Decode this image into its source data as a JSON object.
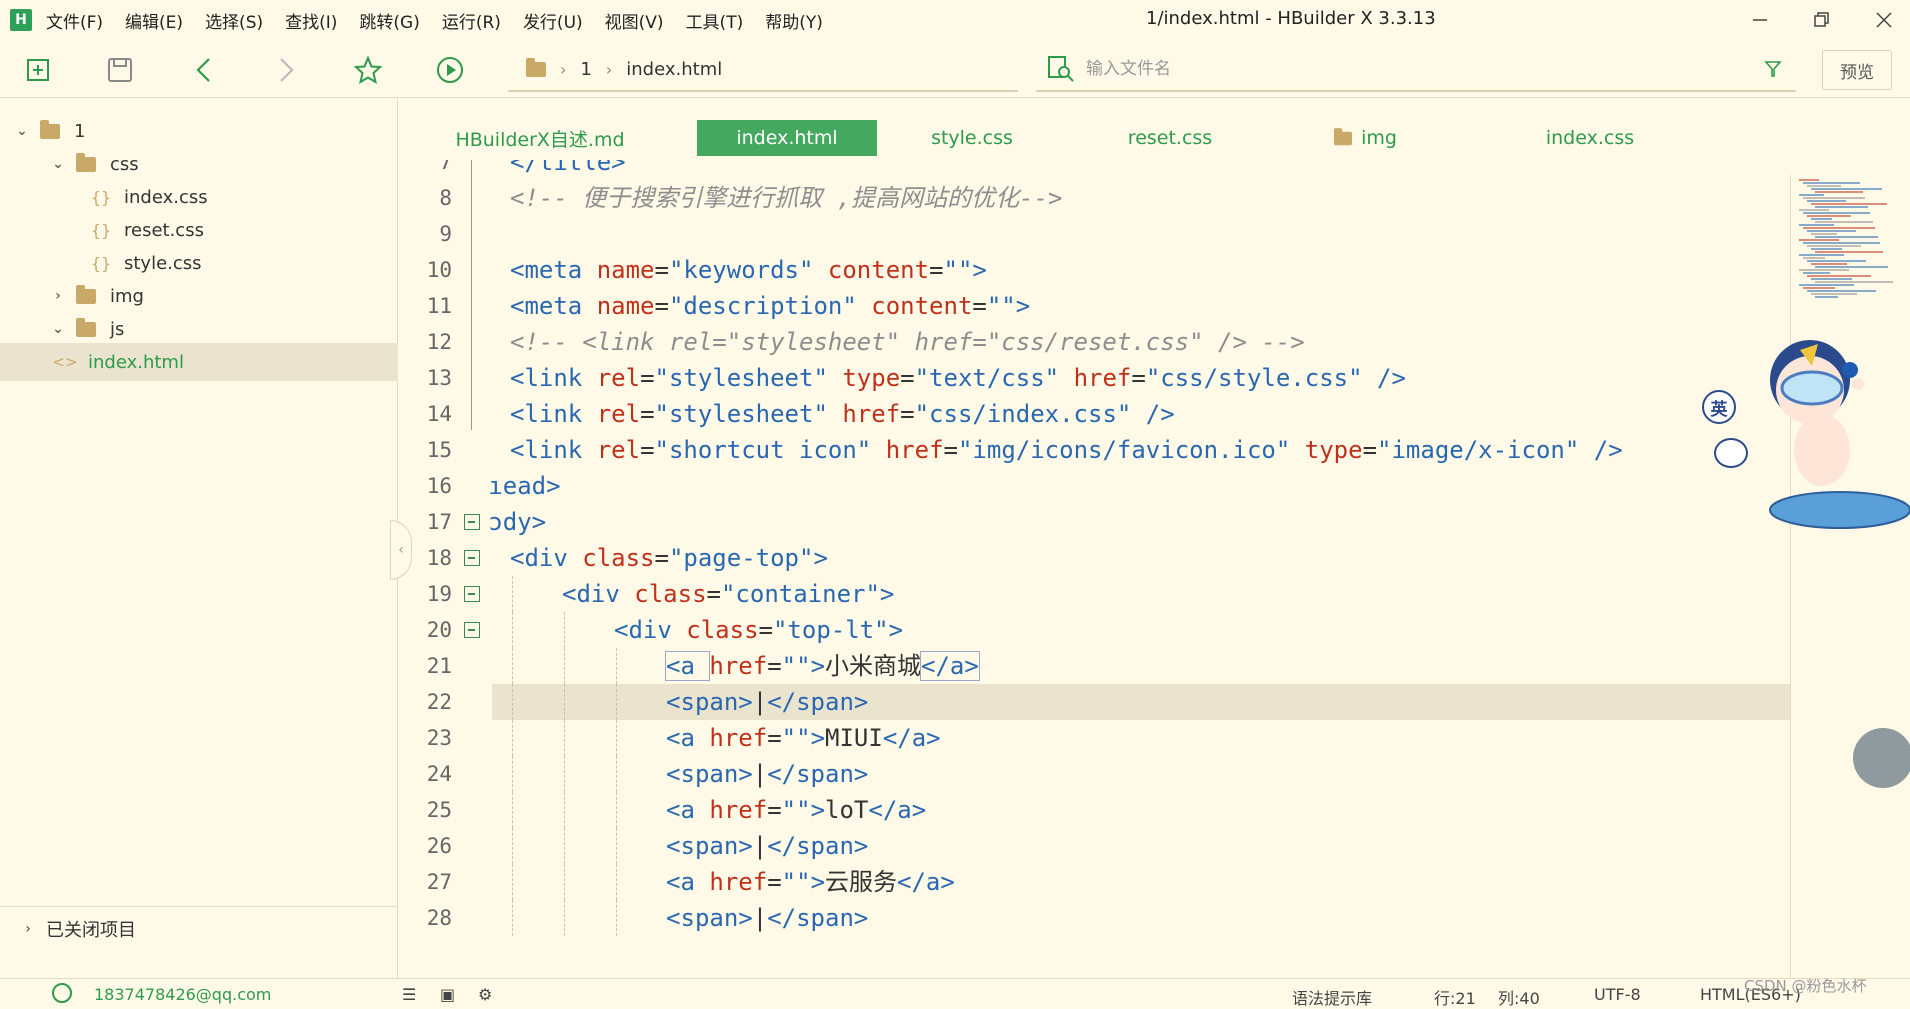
{
  "app": {
    "logo": "H",
    "window_title": "1/index.html - HBuilder X 3.3.13"
  },
  "menu": [
    "文件(F)",
    "编辑(E)",
    "选择(S)",
    "查找(I)",
    "跳转(G)",
    "运行(R)",
    "发行(U)",
    "视图(V)",
    "工具(T)",
    "帮助(Y)"
  ],
  "toolbar": {
    "breadcrumb": [
      "1",
      "index.html"
    ],
    "search_placeholder": "输入文件名",
    "preview_label": "预览"
  },
  "sidebar": {
    "tree": [
      {
        "label": "1",
        "kind": "folder",
        "expanded": true,
        "depth": 0
      },
      {
        "label": "css",
        "kind": "folder",
        "expanded": true,
        "depth": 1
      },
      {
        "label": "index.css",
        "kind": "css",
        "depth": 2
      },
      {
        "label": "reset.css",
        "kind": "css",
        "depth": 2
      },
      {
        "label": "style.css",
        "kind": "css",
        "depth": 2
      },
      {
        "label": "img",
        "kind": "folder",
        "expanded": false,
        "depth": 1
      },
      {
        "label": "js",
        "kind": "folder",
        "expanded": true,
        "depth": 1
      },
      {
        "label": "index.html",
        "kind": "html",
        "depth": 1,
        "selected": true
      }
    ],
    "closed_projects": "已关闭项目"
  },
  "tabs": [
    {
      "label": "HBuilderX自述.md",
      "active": false
    },
    {
      "label": "index.html",
      "active": true
    },
    {
      "label": "style.css",
      "active": false
    },
    {
      "label": "reset.css",
      "active": false
    },
    {
      "label": "img",
      "active": false,
      "folder": true
    },
    {
      "label": "index.css",
      "active": false
    }
  ],
  "editor": {
    "lines": [
      {
        "n": "7",
        "indent": 0,
        "tokens": [
          [
            "tag",
            "</title>"
          ]
        ]
      },
      {
        "n": "8",
        "indent": 0,
        "tokens": [
          [
            "cm",
            "<!-- 便于搜索引擎进行抓取 ,提高网站的优化-->"
          ]
        ]
      },
      {
        "n": "9",
        "indent": 0,
        "tokens": []
      },
      {
        "n": "10",
        "indent": 0,
        "tokens": [
          [
            "tag",
            "<meta "
          ],
          [
            "attr",
            "name"
          ],
          [
            "txt",
            "="
          ],
          [
            "str",
            "\"keywords\""
          ],
          [
            "txt",
            " "
          ],
          [
            "attr",
            "content"
          ],
          [
            "txt",
            "="
          ],
          [
            "str",
            "\"\""
          ],
          [
            "tag",
            ">"
          ]
        ]
      },
      {
        "n": "11",
        "indent": 0,
        "tokens": [
          [
            "tag",
            "<meta "
          ],
          [
            "attr",
            "name"
          ],
          [
            "txt",
            "="
          ],
          [
            "str",
            "\"description\""
          ],
          [
            "txt",
            " "
          ],
          [
            "attr",
            "content"
          ],
          [
            "txt",
            "="
          ],
          [
            "str",
            "\"\""
          ],
          [
            "tag",
            ">"
          ]
        ]
      },
      {
        "n": "12",
        "indent": 0,
        "tokens": [
          [
            "cm",
            "<!-- <link rel=\"stylesheet\" href=\"css/reset.css\" /> -->"
          ]
        ]
      },
      {
        "n": "13",
        "indent": 0,
        "tokens": [
          [
            "tag",
            "<link "
          ],
          [
            "attr",
            "rel"
          ],
          [
            "txt",
            "="
          ],
          [
            "str",
            "\"stylesheet\""
          ],
          [
            "txt",
            " "
          ],
          [
            "attr",
            "type"
          ],
          [
            "txt",
            "="
          ],
          [
            "str",
            "\"text/css\""
          ],
          [
            "txt",
            " "
          ],
          [
            "attr",
            "href"
          ],
          [
            "txt",
            "="
          ],
          [
            "str",
            "\"css/style.css\""
          ],
          [
            "tag",
            " />"
          ]
        ]
      },
      {
        "n": "14",
        "indent": 0,
        "tokens": [
          [
            "tag",
            "<link "
          ],
          [
            "attr",
            "rel"
          ],
          [
            "txt",
            "="
          ],
          [
            "str",
            "\"stylesheet\""
          ],
          [
            "txt",
            " "
          ],
          [
            "attr",
            "href"
          ],
          [
            "txt",
            "="
          ],
          [
            "str",
            "\"css/index.css\""
          ],
          [
            "tag",
            " />"
          ]
        ]
      },
      {
        "n": "15",
        "indent": 0,
        "tokens": [
          [
            "tag",
            "<link "
          ],
          [
            "attr",
            "rel"
          ],
          [
            "txt",
            "="
          ],
          [
            "str",
            "\"shortcut icon\""
          ],
          [
            "txt",
            " "
          ],
          [
            "attr",
            "href"
          ],
          [
            "txt",
            "="
          ],
          [
            "str",
            "\"img/icons/favicon.ico\""
          ],
          [
            "txt",
            " "
          ],
          [
            "attr",
            "type"
          ],
          [
            "txt",
            "="
          ],
          [
            "str",
            "\"image/x-icon\""
          ],
          [
            "tag",
            " />"
          ]
        ]
      },
      {
        "n": "16",
        "indent": -1,
        "tokens": [
          [
            "tag",
            "ıead>"
          ]
        ]
      },
      {
        "n": "17",
        "indent": -1,
        "tokens": [
          [
            "tag",
            "ɔdy>"
          ]
        ]
      },
      {
        "n": "18",
        "indent": 0,
        "tokens": [
          [
            "tag",
            "<div "
          ],
          [
            "attr",
            "class"
          ],
          [
            "txt",
            "="
          ],
          [
            "str",
            "\"page-top\""
          ],
          [
            "tag",
            ">"
          ]
        ]
      },
      {
        "n": "19",
        "indent": 1,
        "tokens": [
          [
            "tag",
            "<div "
          ],
          [
            "attr",
            "class"
          ],
          [
            "txt",
            "="
          ],
          [
            "str",
            "\"container\""
          ],
          [
            "tag",
            ">"
          ]
        ]
      },
      {
        "n": "20",
        "indent": 2,
        "tokens": [
          [
            "tag",
            "<div "
          ],
          [
            "attr",
            "class"
          ],
          [
            "txt",
            "="
          ],
          [
            "str",
            "\"top-lt\""
          ],
          [
            "tag",
            ">"
          ]
        ]
      },
      {
        "n": "21",
        "indent": 3,
        "tokens": [
          [
            "tag",
            "<a "
          ],
          [
            "attr",
            "href"
          ],
          [
            "txt",
            "="
          ],
          [
            "str",
            "\"\""
          ],
          [
            "tag",
            ">"
          ],
          [
            "txt",
            "小米商城"
          ],
          [
            "tag",
            "</a>"
          ]
        ]
      },
      {
        "n": "22",
        "indent": 3,
        "tokens": [
          [
            "tag",
            "<span>"
          ],
          [
            "txt",
            "|"
          ],
          [
            "tag",
            "</span>"
          ]
        ]
      },
      {
        "n": "23",
        "indent": 3,
        "tokens": [
          [
            "tag",
            "<a "
          ],
          [
            "attr",
            "href"
          ],
          [
            "txt",
            "="
          ],
          [
            "str",
            "\"\""
          ],
          [
            "tag",
            ">"
          ],
          [
            "txt",
            "MIUI"
          ],
          [
            "tag",
            "</a>"
          ]
        ]
      },
      {
        "n": "24",
        "indent": 3,
        "tokens": [
          [
            "tag",
            "<span>"
          ],
          [
            "txt",
            "|"
          ],
          [
            "tag",
            "</span>"
          ]
        ]
      },
      {
        "n": "25",
        "indent": 3,
        "tokens": [
          [
            "tag",
            "<a "
          ],
          [
            "attr",
            "href"
          ],
          [
            "txt",
            "="
          ],
          [
            "str",
            "\"\""
          ],
          [
            "tag",
            ">"
          ],
          [
            "txt",
            "loT"
          ],
          [
            "tag",
            "</a>"
          ]
        ]
      },
      {
        "n": "26",
        "indent": 3,
        "tokens": [
          [
            "tag",
            "<span>"
          ],
          [
            "txt",
            "|"
          ],
          [
            "tag",
            "</span>"
          ]
        ]
      },
      {
        "n": "27",
        "indent": 3,
        "tokens": [
          [
            "tag",
            "<a "
          ],
          [
            "attr",
            "href"
          ],
          [
            "txt",
            "="
          ],
          [
            "str",
            "\"\""
          ],
          [
            "tag",
            ">"
          ],
          [
            "txt",
            "云服务"
          ],
          [
            "tag",
            "</a>"
          ]
        ]
      },
      {
        "n": "28",
        "indent": 3,
        "tokens": [
          [
            "tag",
            "<span>"
          ],
          [
            "txt",
            "|"
          ],
          [
            "tag",
            "</span>"
          ]
        ]
      }
    ],
    "fold_lines": [
      "17",
      "18",
      "19",
      "20"
    ],
    "current_line": "21"
  },
  "mascot_badge": "英",
  "statusbar": {
    "account": "1837478426@qq.com",
    "syntax": "语法提示库",
    "line": "行:21",
    "col": "列:40",
    "encoding": "UTF-8",
    "lang": "HTML(ES6+)",
    "watermark": "CSDN @粉色水杯"
  },
  "colors": {
    "background": "#fffae8",
    "accent": "#45a85f",
    "tag": "#2a67b1",
    "attr": "#c0311b",
    "comment": "#8d8d8d"
  }
}
